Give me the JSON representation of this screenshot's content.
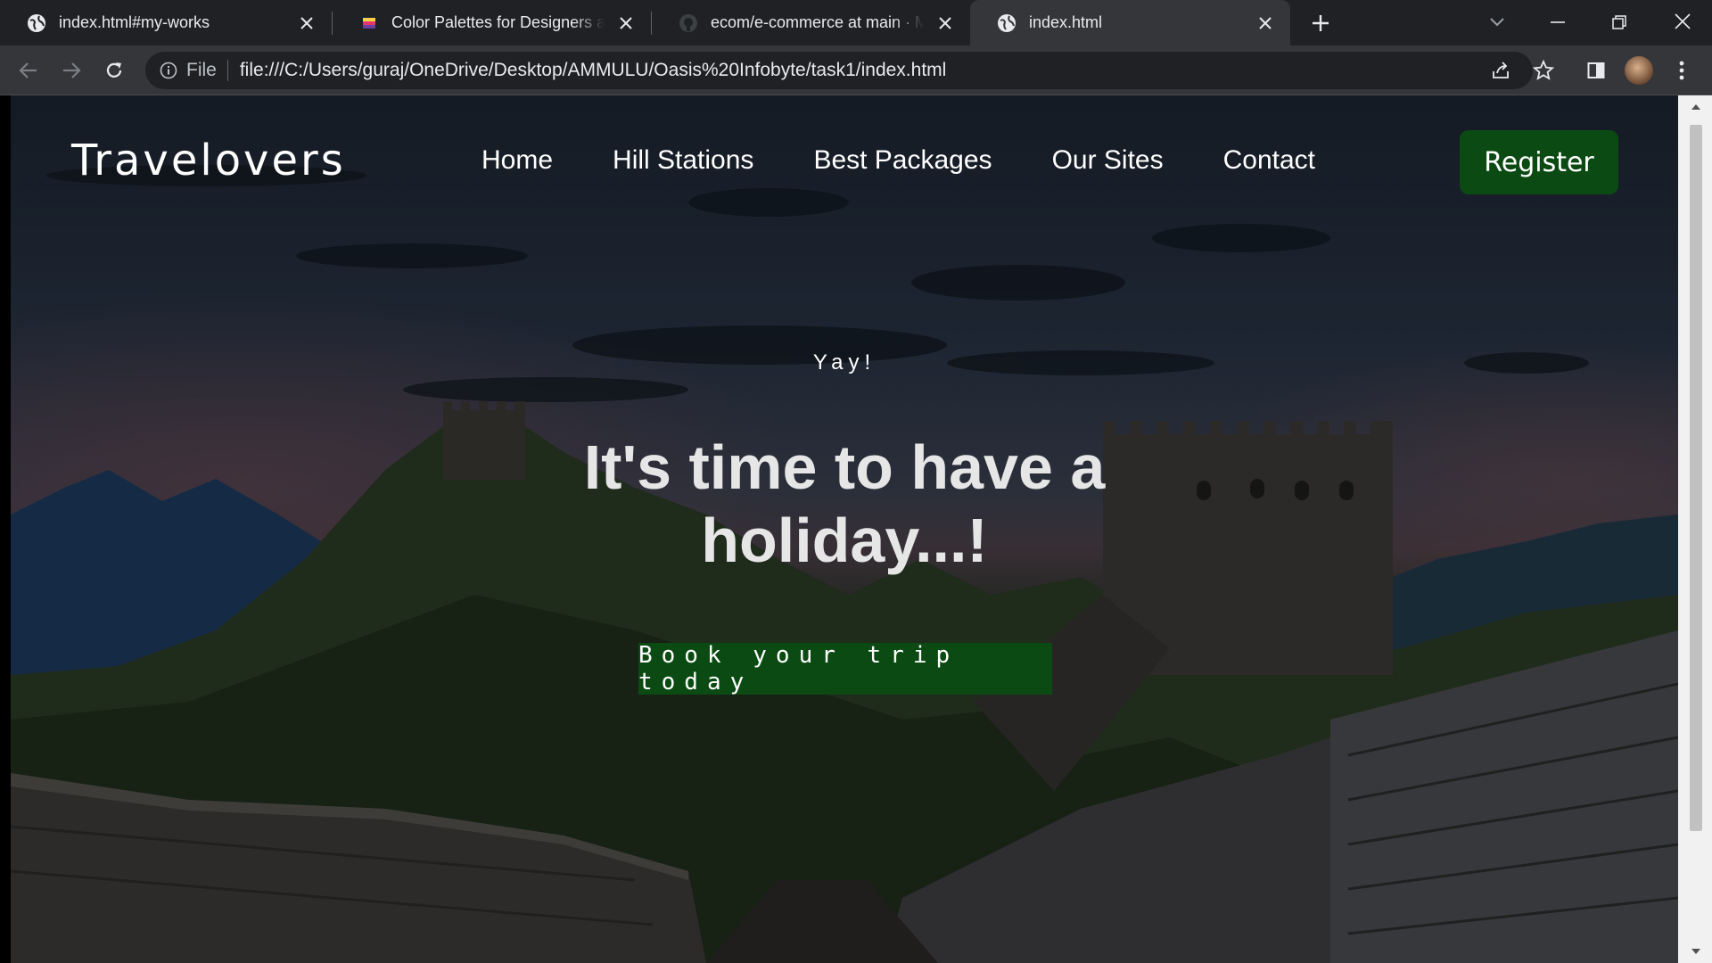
{
  "browser": {
    "tabs": [
      {
        "title": "index.html#my-works",
        "icon": "globe-icon"
      },
      {
        "title": "Color Palettes for Designers and Artists",
        "icon": "palette-favicon"
      },
      {
        "title": "ecom/e-commerce at main · Microsoft",
        "icon": "github-icon"
      },
      {
        "title": "index.html",
        "icon": "globe-icon",
        "active": true
      }
    ],
    "address_bar": {
      "scheme_label": "File",
      "url": "file:///C:/Users/guraj/OneDrive/Desktop/AMMULU/Oasis%20Infobyte/task1/index.html"
    }
  },
  "site": {
    "logo": "Travelovers",
    "nav": [
      "Home",
      "Hill Stations",
      "Best Packages",
      "Our Sites",
      "Contact"
    ],
    "register_label": "Register",
    "hero": {
      "eyebrow": "Yay!",
      "title": "It's time to have a holiday...!",
      "cta_label": "Book your trip today"
    }
  },
  "colors": {
    "button_green": "#0b4a12",
    "chrome_dark": "#202124",
    "chrome_toolbar": "#35363a"
  }
}
